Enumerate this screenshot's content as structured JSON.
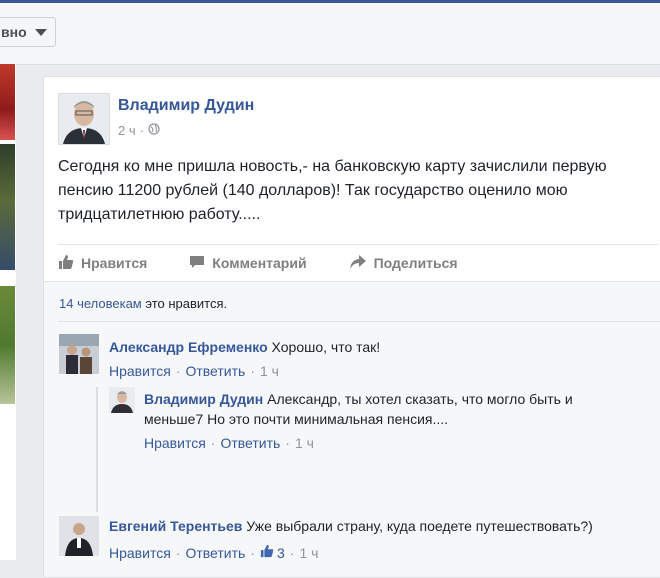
{
  "header": {
    "sort_label": "вно"
  },
  "post": {
    "author": "Владимир Дудин",
    "time": "2 ч",
    "separator": "·",
    "text": "Сегодня ко мне пришла новость,- на банковскую карту зачислили первую\nпенсию 11200 рублей (140 долларов)! Так государство оценило мою\nтридцатилетнюю работу.....",
    "actions": {
      "like": "Нравится",
      "comment": "Комментарий",
      "share": "Поделиться"
    },
    "likes": {
      "count_link": "14 человекам",
      "suffix": " это нравится."
    }
  },
  "comments": [
    {
      "author": "Александр Ефременко",
      "text": " Хорошо, что так!",
      "like": "Нравится",
      "reply": "Ответить",
      "time": "1 ч",
      "sep": "·"
    },
    {
      "author": "Владимир Дудин",
      "text": " Александр, ты хотел сказать, что могло быть и меньше7 Но это почти минимальная пенсия....",
      "like": "Нравится",
      "reply": "Ответить",
      "time": "1 ч",
      "sep": "·"
    },
    {
      "author": "Евгений Терентьев",
      "text": " Уже выбрали страну, куда поедете путешествовать?)",
      "like": "Нравится",
      "reply": "Ответить",
      "like_count": "3",
      "time": "1 ч",
      "sep": "·"
    }
  ],
  "colors": {
    "link": "#365899",
    "muted": "#90949c",
    "brand": "#3b5998"
  },
  "icons": [
    "caret-down-icon",
    "globe-icon",
    "thumbs-up-icon",
    "comment-icon",
    "share-arrow-icon",
    "chevron-down-icon"
  ]
}
